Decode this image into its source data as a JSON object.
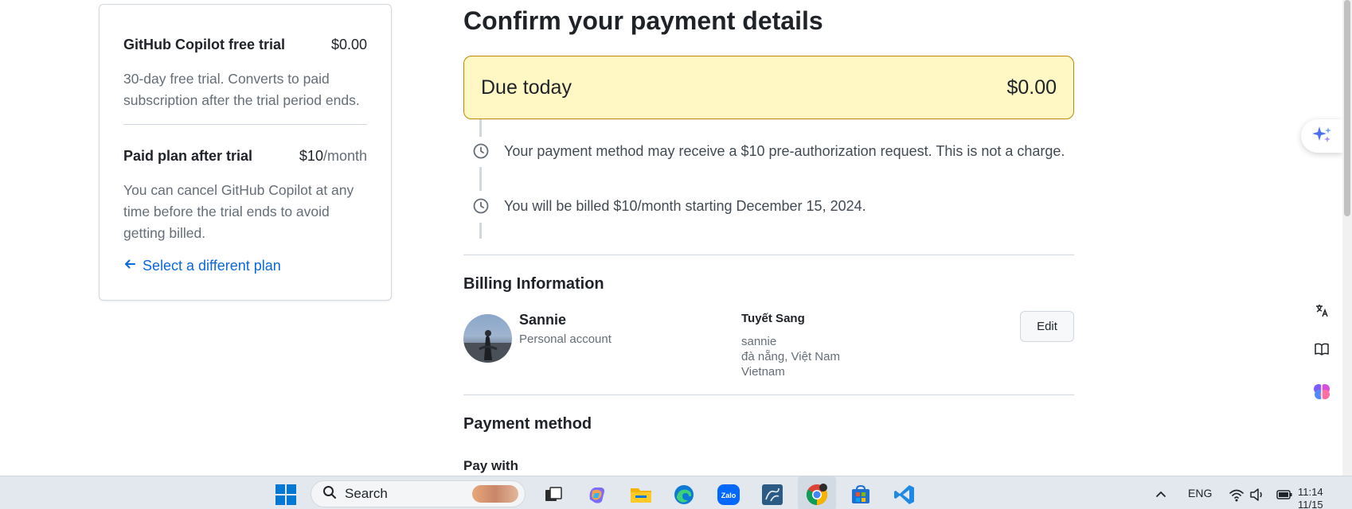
{
  "summary": {
    "trial_label": "GitHub Copilot free trial",
    "trial_amount": "$0.00",
    "trial_desc": "30-day free trial. Converts to paid subscription after the trial period ends.",
    "paid_label": "Paid plan after trial",
    "paid_amount": "$10",
    "paid_unit": "/month",
    "paid_desc": "You can cancel GitHub Copilot at any time before the trial ends to avoid getting billed.",
    "back_link": "Select a different plan"
  },
  "main": {
    "title": "Confirm your payment details",
    "due_label": "Due today",
    "due_amount": "$0.00",
    "notices": [
      "Your payment method may receive a $10 pre-authorization request. This is not a charge.",
      "You will be billed $10/month starting December 15, 2024."
    ],
    "billing_title": "Billing Information",
    "account_name": "Sannie",
    "account_type": "Personal account",
    "bill_name": "Tuyết Sang",
    "bill_address": [
      "sannie",
      "đà nẵng, Việt Nam",
      "Vietnam"
    ],
    "edit_label": "Edit",
    "payment_title": "Payment method",
    "pay_with": "Pay with"
  },
  "taskbar": {
    "search_label": "Search",
    "apps": [
      "windows-start",
      "search",
      "task-view",
      "copilot",
      "file-explorer",
      "edge",
      "zalo",
      "mysql-workbench",
      "chrome",
      "microsoft-store",
      "vscode"
    ],
    "lang": "ENG",
    "time": "11:14",
    "date": "11/15"
  },
  "colors": {
    "due_bg": "#fff8c5",
    "due_border": "#bf8700",
    "link": "#0969da",
    "muted": "#656d76"
  }
}
